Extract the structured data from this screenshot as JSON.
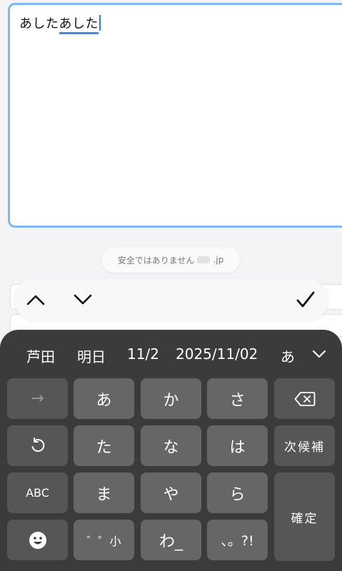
{
  "editor": {
    "committed": "あした",
    "composing": "あした"
  },
  "domain_banner": {
    "text": "安全ではありません",
    "domain_suffix": ".jp"
  },
  "nav": {
    "prev_icon": "chevron-up-icon",
    "next_icon": "chevron-down-icon",
    "done_icon": "checkmark-icon"
  },
  "candidates": [
    "芦田",
    "明日",
    "11/2",
    "2025/11/02",
    "あ"
  ],
  "keys": {
    "next_arrow": "→",
    "a": "あ",
    "ka": "か",
    "sa": "さ",
    "ta": "た",
    "na": "な",
    "ha": "は",
    "ma": "ま",
    "ya": "や",
    "ra": "ら",
    "wa": "わ_",
    "dakuten": "゛゜小",
    "punct": "、。?!",
    "abc": "ABC",
    "next_candidate": "次候補",
    "confirm": "確定"
  },
  "colors": {
    "focus_border": "#7fb8ee",
    "composing_underline": "#3a8ae8",
    "keyboard_bg": "#3b3b3d",
    "key_bg": "#666668"
  }
}
